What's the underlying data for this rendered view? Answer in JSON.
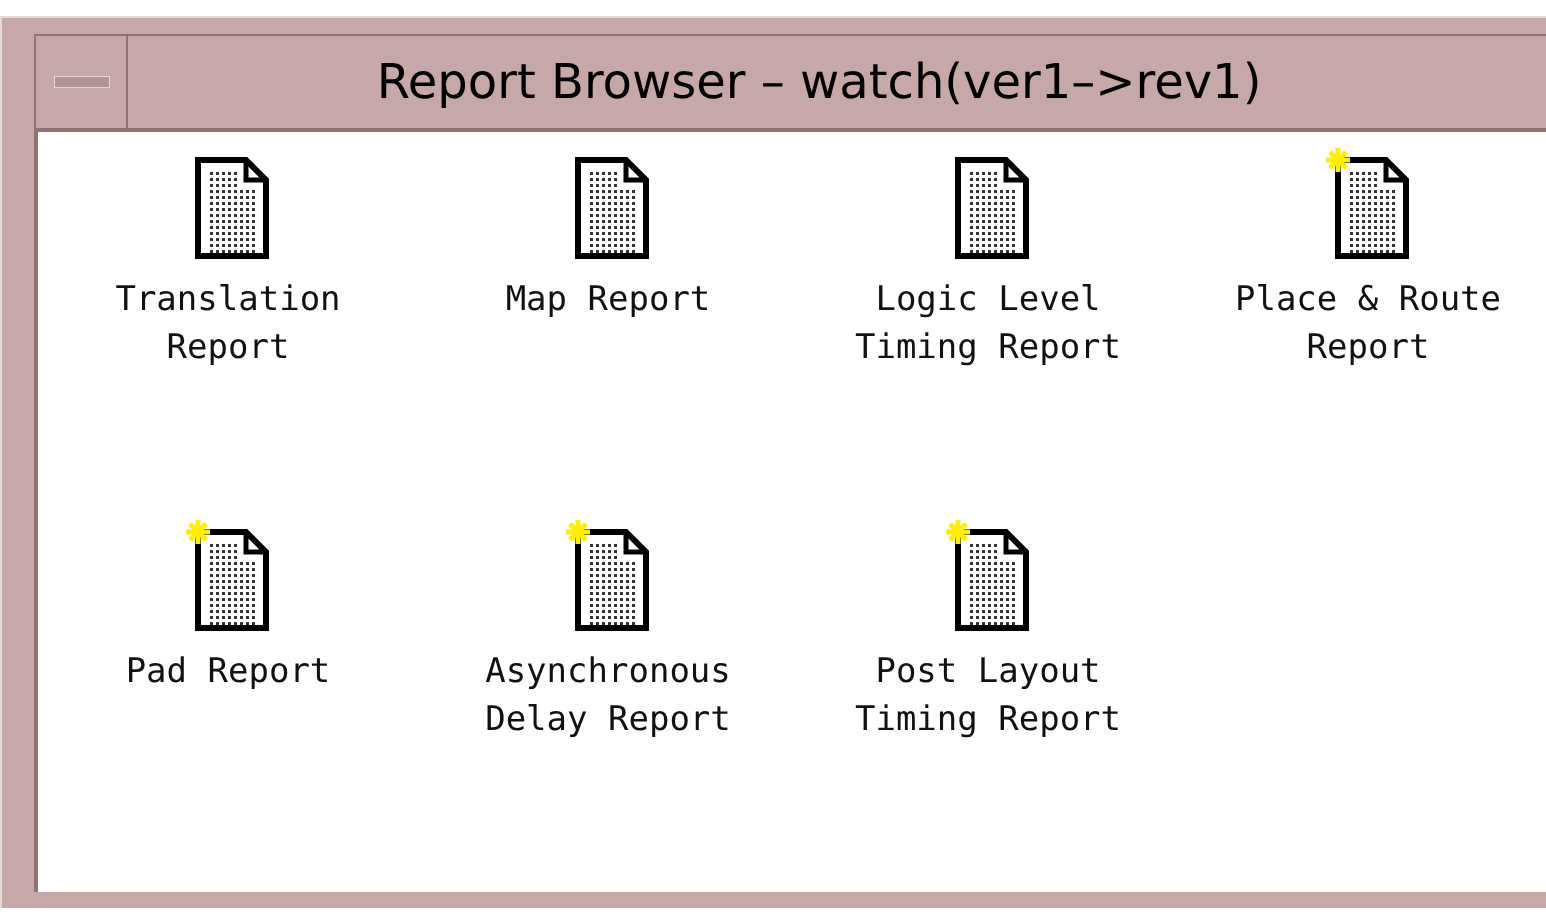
{
  "window": {
    "title": "Report Browser – watch(ver1–>rev1)"
  },
  "reports": [
    {
      "label": "Translation\nReport",
      "new": false
    },
    {
      "label": "Map Report",
      "new": false
    },
    {
      "label": "Logic Level\nTiming Report",
      "new": false
    },
    {
      "label": "Place & Route\nReport",
      "new": true
    },
    {
      "label": "Pad Report",
      "new": true
    },
    {
      "label": "Asynchronous\nDelay Report",
      "new": true
    },
    {
      "label": "Post Layout\nTiming Report",
      "new": true
    }
  ]
}
